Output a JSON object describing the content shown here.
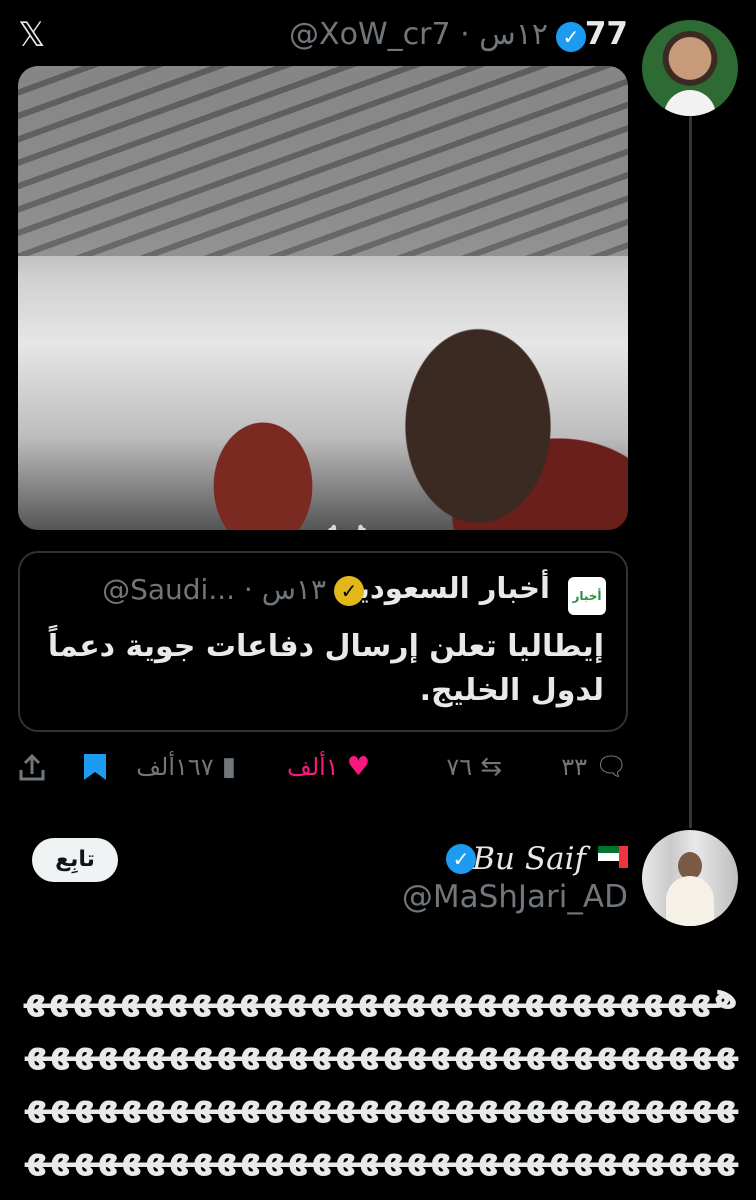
{
  "app": {
    "logo_glyph": "𝕏"
  },
  "tweet": {
    "count": "77",
    "handle": "@XoW_cr7 · ١٢س",
    "verified_color": "#1d9bf0",
    "video": {
      "mute_glyph": "🔇",
      "emoji": "☠️"
    },
    "quote": {
      "logo_text": "أخبار",
      "name": "أخبار السعودية",
      "badge_color": "#e2b719",
      "handle": "@Saudi... · ١٣س",
      "text": "إيطاليا تعلن إرسال دفاعات جوية دعماً لدول الخليج."
    },
    "actions": {
      "reply_icon": "speech-bubble-icon",
      "reply_count": "٣٣",
      "retweet_icon": "retweet-icon",
      "retweet_count": "٧٦",
      "like_icon": "heart-icon",
      "like_count": "١ألف",
      "views_icon": "bar-chart-icon",
      "views_count": "١٦٧ألف",
      "bookmark_icon": "bookmark-icon",
      "share_icon": "share-icon"
    }
  },
  "reply": {
    "name": "Bu Saif",
    "flag": "uae-flag",
    "handle": "@MaShJari_AD",
    "follow_label": "تابِع",
    "body": "هههههههههههههههههههههههههههههههههههههههههههههههههههههههههههههههههههههههههههههههههههههههههههههههههههههههههههههههههههههههههههههههههه"
  },
  "colors": {
    "background": "#000000",
    "like": "#f91880",
    "muted": "#71767b"
  }
}
